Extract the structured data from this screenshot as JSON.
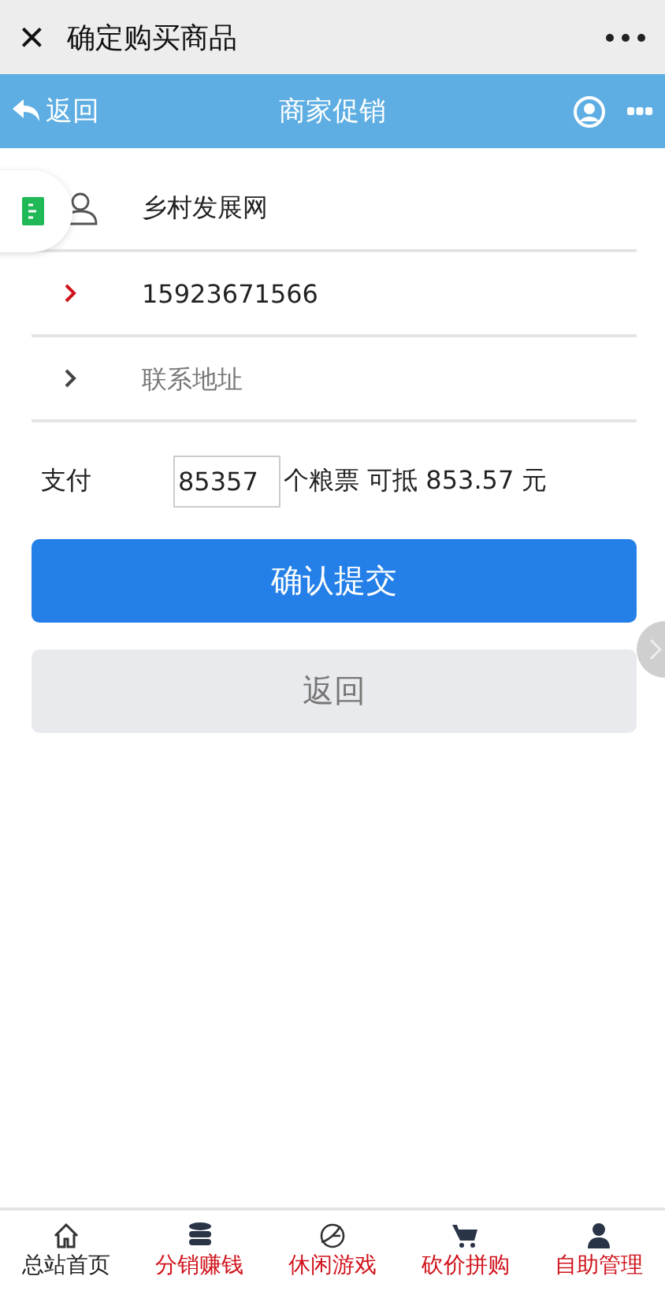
{
  "window": {
    "title": "确定购买商品",
    "close": "×"
  },
  "header": {
    "back": "返回",
    "title": "商家促销"
  },
  "fields": [
    {
      "kind": "person",
      "value": "乡村发展网",
      "focused": false
    },
    {
      "kind": "chevron",
      "value": "15923671566",
      "focused": true
    },
    {
      "kind": "chevron",
      "placeholder": "联系地址",
      "focused": false
    }
  ],
  "payment": {
    "label": "支付",
    "value": "85357",
    "suffix": "个粮票 可抵 853.57 元"
  },
  "buttons": [
    {
      "kind": "primary",
      "label": "确认提交"
    },
    {
      "kind": "secondary",
      "label": "返回"
    }
  ],
  "tabbar": [
    {
      "kind": "home",
      "label": "总站首页",
      "selected": true
    },
    {
      "kind": "coins",
      "label": "分销赚钱",
      "selected": false
    },
    {
      "kind": "game",
      "label": "休闲游戏",
      "selected": false
    },
    {
      "kind": "cart",
      "label": "砍价拼购",
      "selected": false
    },
    {
      "kind": "user",
      "label": "自助管理",
      "selected": false
    }
  ]
}
